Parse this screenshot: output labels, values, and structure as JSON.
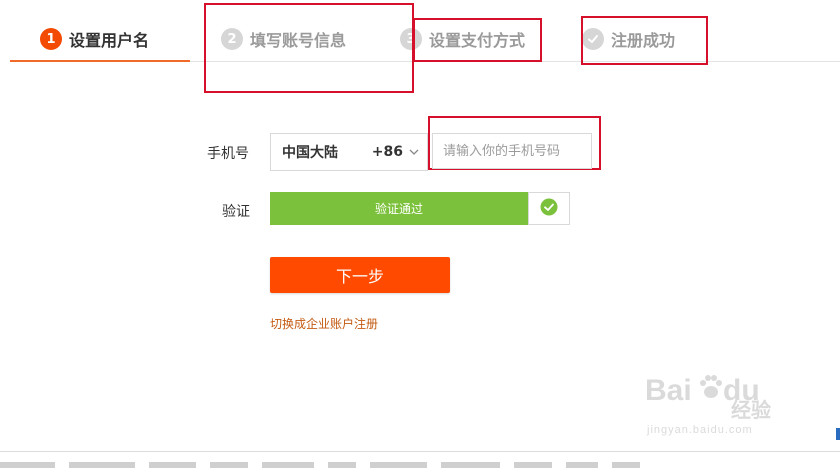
{
  "steps": [
    {
      "number": "1",
      "label": "设置用户名"
    },
    {
      "number": "2",
      "label": "填写账号信息"
    },
    {
      "number": "3",
      "label": "设置支付方式"
    },
    {
      "number": "",
      "label": "注册成功"
    }
  ],
  "form": {
    "phone_label": "手机号",
    "region_name": "中国大陆",
    "region_code": "+86",
    "phone_placeholder": "请输入你的手机号码",
    "phone_value": "",
    "verify_label": "验证",
    "verify_status": "验证通过",
    "next_label": "下一步",
    "switch_link": "切换成企业账户注册"
  },
  "watermark": {
    "brand": "Bai",
    "brand2": "du",
    "suffix": "经验",
    "url": "jingyan.baidu.com"
  },
  "colors": {
    "accent": "#f44b04",
    "verify_green": "#7cc13b",
    "next_button": "#ff4a00",
    "annotation_red": "#d6102a",
    "link": "#c45a12"
  }
}
